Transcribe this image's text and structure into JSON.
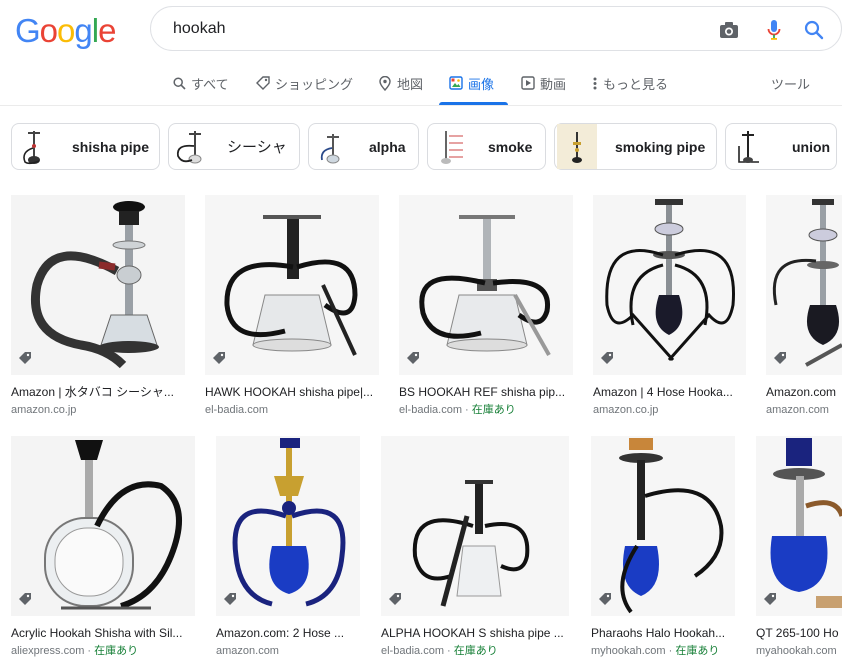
{
  "logo": {
    "letters": [
      "G",
      "o",
      "o",
      "g",
      "l",
      "e"
    ],
    "colors": [
      "#4285f4",
      "#ea4335",
      "#fbbc05",
      "#4285f4",
      "#34a853",
      "#ea4335"
    ]
  },
  "search": {
    "query": "hookah"
  },
  "tabs": [
    {
      "label": "すべて",
      "icon": "search-icon"
    },
    {
      "label": "ショッピング",
      "icon": "tag-icon"
    },
    {
      "label": "地図",
      "icon": "map-pin-icon"
    },
    {
      "label": "画像",
      "icon": "image-icon",
      "active": true
    },
    {
      "label": "動画",
      "icon": "video-icon"
    },
    {
      "label": "もっと見る",
      "icon": "more-vert-icon"
    }
  ],
  "tools_label": "ツール",
  "chips": [
    {
      "label": "shisha pipe"
    },
    {
      "label": "シーシャ"
    },
    {
      "label": "alpha"
    },
    {
      "label": "smoke"
    },
    {
      "label": "smoking pipe"
    },
    {
      "label": "union"
    }
  ],
  "row1": [
    {
      "title": "Amazon | 水タバコ シーシャ...",
      "source": "amazon.co.jp",
      "stock": ""
    },
    {
      "title": "HAWK HOOKAH shisha pipe|...",
      "source": "el-badia.com",
      "stock": ""
    },
    {
      "title": "BS HOOKAH REF shisha pip...",
      "source": "el-badia.com",
      "stock": "在庫あり"
    },
    {
      "title": "Amazon | 4 Hose Hooka...",
      "source": "amazon.co.jp",
      "stock": ""
    },
    {
      "title": "Amazon.com",
      "source": "amazon.com",
      "stock": ""
    }
  ],
  "row2": [
    {
      "title": "Acrylic Hookah Shisha with Sil...",
      "source": "aliexpress.com",
      "stock": "在庫あり"
    },
    {
      "title": "Amazon.com: 2 Hose ...",
      "source": "amazon.com",
      "stock": ""
    },
    {
      "title": "ALPHA HOOKAH S shisha pipe ...",
      "source": "el-badia.com",
      "stock": "在庫あり"
    },
    {
      "title": "Pharaohs Halo Hookah...",
      "source": "myhookah.com",
      "stock": "在庫あり"
    },
    {
      "title": "QT 265-100 Ho",
      "source": "myahookah.com",
      "stock": ""
    }
  ],
  "stock_separator": " · ",
  "colors": {
    "accent": "#1a73e8",
    "stock": "#188038"
  }
}
